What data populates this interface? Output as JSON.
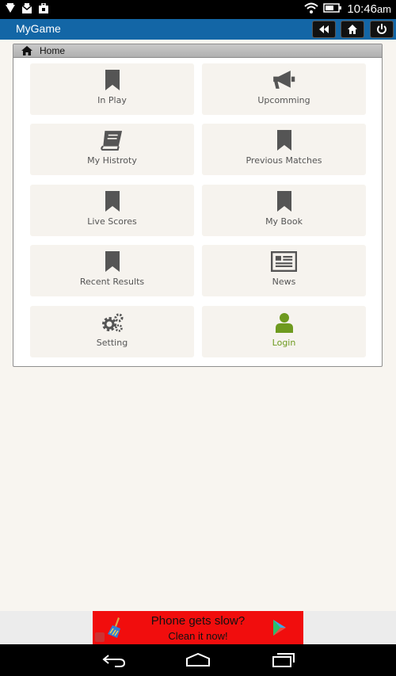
{
  "status_bar": {
    "time": "10:46",
    "ampm": "am",
    "icons": [
      "notification-icon",
      "mail-icon",
      "bag-icon",
      "wifi-icon",
      "battery-icon"
    ]
  },
  "app_bar": {
    "title": "MyGame",
    "buttons": [
      "rewind-icon",
      "home-icon",
      "power-icon"
    ],
    "bg_color": "#1366a6"
  },
  "breadcrumb": {
    "label": "Home"
  },
  "tiles": [
    {
      "label": "In Play",
      "icon": "bookmark-icon"
    },
    {
      "label": "Upcomming",
      "icon": "megaphone-icon"
    },
    {
      "label": "My Histroty",
      "icon": "book-icon"
    },
    {
      "label": "Previous Matches",
      "icon": "bookmark-icon"
    },
    {
      "label": "Live Scores",
      "icon": "bookmark-icon"
    },
    {
      "label": "My Book",
      "icon": "bookmark-icon"
    },
    {
      "label": "Recent Results",
      "icon": "bookmark-icon"
    },
    {
      "label": "News",
      "icon": "newspaper-icon"
    },
    {
      "label": "Setting",
      "icon": "gears-icon"
    },
    {
      "label": "Login",
      "icon": "user-icon",
      "color": "#6e9a1f"
    }
  ],
  "ad": {
    "line1": "Phone gets slow?",
    "line2": "Clean it now!",
    "bg_color": "#f10d0d"
  },
  "nav_bar": {
    "buttons": [
      "back-icon",
      "home-nav-icon",
      "recents-icon"
    ]
  }
}
